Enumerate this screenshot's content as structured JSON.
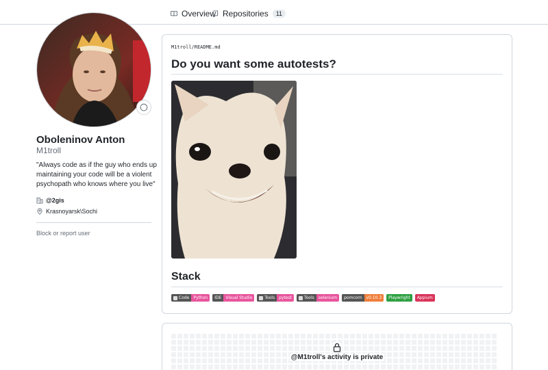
{
  "nav": {
    "tabs": [
      {
        "label": "Overview",
        "icon": "book-icon"
      },
      {
        "label": "Repositories",
        "icon": "repo-icon",
        "count": "11"
      }
    ]
  },
  "profile": {
    "name": "Oboleninov Anton",
    "login": "M1troll",
    "bio_lines": [
      "\"Always code as if the guy who ends up",
      "maintaining your code will be a violent",
      "psychopath who knows where you live\""
    ],
    "organization": "@2gis",
    "location": "Krasnoyarsk\\Sochi",
    "block_link": "Block or report user"
  },
  "readme": {
    "owner": "M1troll",
    "separator": "/",
    "file": "README.md",
    "heading": "Do you want some autotests?",
    "stack_heading": "Stack",
    "badges": [
      {
        "label": "Code",
        "value": "Python",
        "color": "#e8559d"
      },
      {
        "label": "IDE",
        "value": "Visual Studio",
        "color": "#e8559d"
      },
      {
        "label": "Tools",
        "value": "pytest",
        "color": "#e8559d"
      },
      {
        "label": "Tools",
        "value": "selenium",
        "color": "#e8559d"
      },
      {
        "label": "pomcorn",
        "value": "v0.10.3",
        "color": "#f07f3c"
      },
      {
        "label": "",
        "value": "Playwright",
        "color": "#2ea043"
      },
      {
        "label": "",
        "value": "Appium",
        "color": "#d9345a"
      }
    ]
  },
  "activity": {
    "private_message": "@M1troll's activity is private"
  },
  "colors": {
    "border": "#d0d7de",
    "text": "#1f2328",
    "muted": "#636c76"
  }
}
